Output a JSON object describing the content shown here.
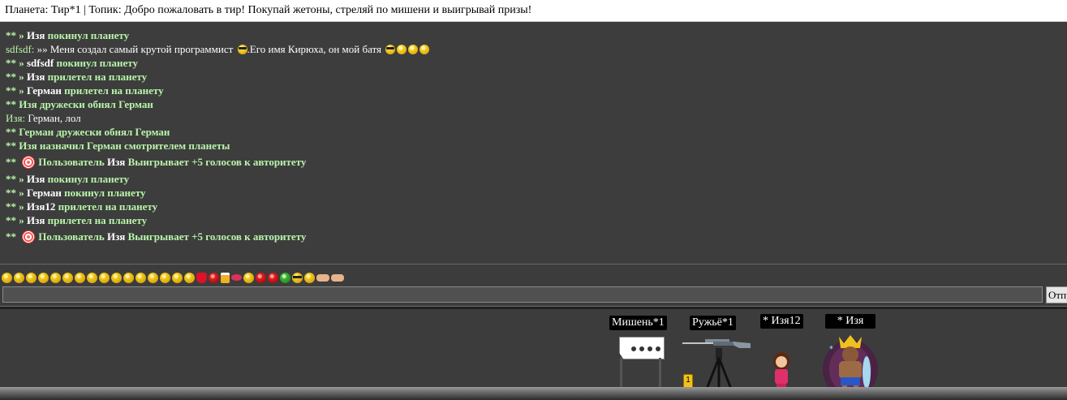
{
  "topic_bar": {
    "text": "Планета: Тир*1 | Топик: Добро пожаловать в тир! Покупай жетоны, стреляй по мишени и выигрывай призы!"
  },
  "chat": {
    "lines": [
      {
        "prefix": "** » ",
        "name": "Изя",
        "text": " покинул планету"
      },
      {
        "sender": "sdfsdf:",
        "text": " »» Меня создал самый крутой программист ",
        "text2": ".Его имя Кирюха, он мой батя "
      },
      {
        "prefix": "** » ",
        "name": "sdfsdf",
        "text": " покинул планету"
      },
      {
        "prefix": "** » ",
        "name": "Изя",
        "text": " прилетел на планету"
      },
      {
        "prefix": "** » ",
        "name": "Герман",
        "text": " прилетел на планету"
      },
      {
        "prefix": "** ",
        "text": "Изя дружески обнял Герман"
      },
      {
        "sender": "Изя:",
        "text": " Герман, лол"
      },
      {
        "prefix": "** ",
        "text": "Герман дружески обнял Герман"
      },
      {
        "prefix": "** ",
        "text": "Изя назначил Герман смотрителем планеты"
      },
      {
        "prefix": "** ",
        "pre": "Пользователь ",
        "name": "Изя",
        "text": " Выигрывает +5 голосов к авторитету"
      },
      {
        "prefix": "** » ",
        "name": "Изя",
        "text": " покинул планету"
      },
      {
        "prefix": "** » ",
        "name": "Герман",
        "text": " покинул планету"
      },
      {
        "prefix": "** » ",
        "name": "Изя12",
        "text": " прилетел на планету"
      },
      {
        "prefix": "** » ",
        "name": "Изя",
        "text": " прилетел на планету"
      },
      {
        "prefix": "** ",
        "pre": "Пользователь ",
        "name": "Изя",
        "text": " Выигрывает +5 голосов к авторитету"
      }
    ],
    "emoji_icons": [
      "smile-icon",
      "grin-icon",
      "blush-icon",
      "wink-icon",
      "happy-icon",
      "tongue-icon",
      "laugh-icon",
      "cry-icon",
      "shock-icon",
      "sad-icon",
      "hmm-icon",
      "angry-icon",
      "worried-icon",
      "confused-icon",
      "silly-icon",
      "scream-icon",
      "heart-icon",
      "stop-icon",
      "beer-icon",
      "lips-icon",
      "kiss-icon",
      "love-icon",
      "devil-icon",
      "alien-icon",
      "cool-icon",
      "crazy-icon",
      "thumb-icon",
      "point-icon"
    ]
  },
  "composer": {
    "input_value": "",
    "send_label": "Отправить"
  },
  "scene": {
    "objects": [
      {
        "label": "Мишень*1"
      },
      {
        "label": "Ружьё*1"
      },
      {
        "label": "* Изя12"
      },
      {
        "label": "* Изя"
      }
    ],
    "token_text": "1"
  },
  "colors": {
    "system_green": "#b9f5a9",
    "chat_bg": "#3d3d3d",
    "name_white": "#ffffff"
  }
}
